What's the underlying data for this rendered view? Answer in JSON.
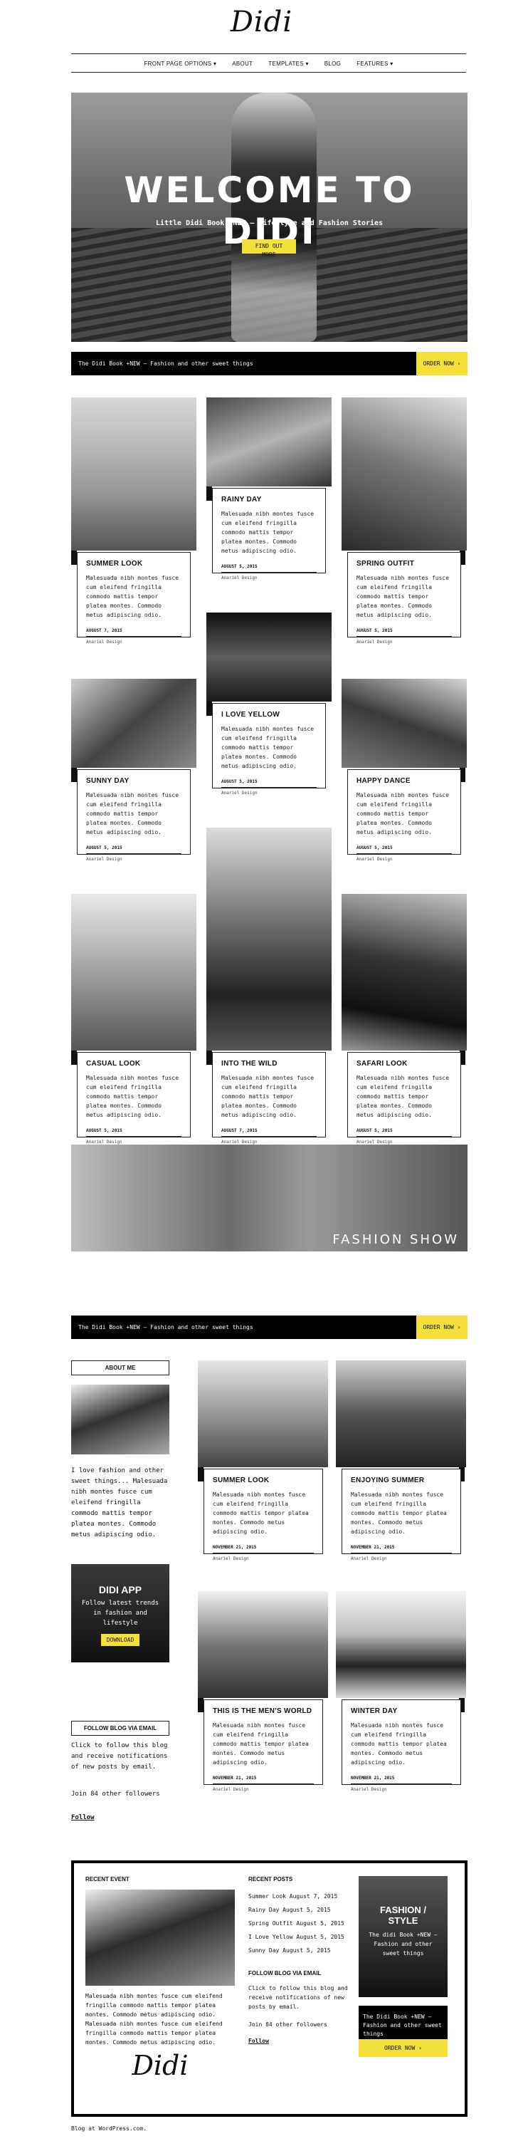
{
  "site": {
    "logo": "Didi"
  },
  "nav": [
    "FRONT PAGE OPTIONS ▾",
    "ABOUT",
    "TEMPLATES ▾",
    "BLOG",
    "FEATURES ▾"
  ],
  "hero": {
    "title": "WELCOME TO DIDI",
    "subtitle": "Little Didi Book +NEW – Lifestyle and Fashion Stories",
    "button": "FIND OUT MORE"
  },
  "promo": {
    "text": "The Didi Book +NEW – Fashion and other sweet things",
    "button": "ORDER NOW ›"
  },
  "excerpt": "Malesuada nibh montes fusce cum eleifend fringilla commodo mattis tempor platea montes. Commodo metus adipiscing odio.",
  "author": "Anariel Design",
  "posts": [
    {
      "title": "SUMMER LOOK",
      "date": "AUGUST 7, 2015"
    },
    {
      "title": "RAINY DAY",
      "date": "AUGUST 5, 2015"
    },
    {
      "title": "SPRING OUTFIT",
      "date": "AUGUST 5, 2015"
    },
    {
      "title": "I LOVE YELLOW",
      "date": "AUGUST 5, 2015"
    },
    {
      "title": "SUNNY DAY",
      "date": "AUGUST 5, 2015"
    },
    {
      "title": "HAPPY DANCE",
      "date": "AUGUST 5, 2015"
    },
    {
      "title": "CASUAL LOOK",
      "date": "AUGUST 5, 2015"
    },
    {
      "title": "INTO THE WILD",
      "date": "AUGUST 7, 2015"
    },
    {
      "title": "SAFARI LOOK",
      "date": "AUGUST 5, 2015"
    }
  ],
  "banner": {
    "text": "FASHION SHOW"
  },
  "sidebar": {
    "about_title": "ABOUT ME",
    "about_text": "I love fashion and other sweet things... Malesuada nibh montes fusce cum eleifend fringilla commodo mattis tempor platea montes. Commodo metus adipiscing odio.",
    "app_title": "DIDI APP",
    "app_text": "Follow latest trends in fashion and lifestyle",
    "app_button": "DOWNLOAD",
    "follow_title": "FOLLOW BLOG VIA EMAIL",
    "follow_text": "Click to follow this blog and receive notifications of new posts by email.",
    "join": "Join 84 other followers",
    "follow_link": "Follow"
  },
  "posts2": [
    {
      "title": "SUMMER LOOK",
      "date": "NOVEMBER 21, 2015"
    },
    {
      "title": "ENJOYING SUMMER",
      "date": "NOVEMBER 21, 2015"
    },
    {
      "title": "THIS IS THE MEN'S WORLD",
      "date": "NOVEMBER 21, 2015"
    },
    {
      "title": "WINTER DAY",
      "date": "NOVEMBER 21, 2015"
    }
  ],
  "footer": {
    "recent_event": "RECENT EVENT",
    "event_text": "Malesuada nibh montes fusce cum eleifend fringilla commodo mattis tempor platea montes. Commodo metus adipiscing odio. Malesuada nibh montes fusce cum eleifend fringilla commodo mattis tempor platea montes. Commodo metus adipiscing odio.",
    "recent_posts": "RECENT POSTS",
    "recent_list": [
      "Summer Look August 7, 2015",
      "Rainy Day August 5, 2015",
      "Spring Outfit August 5, 2015",
      "I Love Yellow August 5, 2015",
      "Sunny Day August 5, 2015"
    ],
    "follow_title": "FOLLOW BLOG VIA EMAIL",
    "follow_text": "Click to follow this blog and receive notifications of new posts by email.",
    "join": "Join 84 other followers",
    "follow_link": "Follow",
    "fashion_title": "FASHION / STYLE",
    "fashion_text": "The didi Book +NEW – Fashion and other sweet things",
    "order_text": "The Didi Book +NEW – Fashion and other sweet things",
    "order_button": "ORDER NOW ›"
  },
  "credit": "Blog at WordPress.com."
}
